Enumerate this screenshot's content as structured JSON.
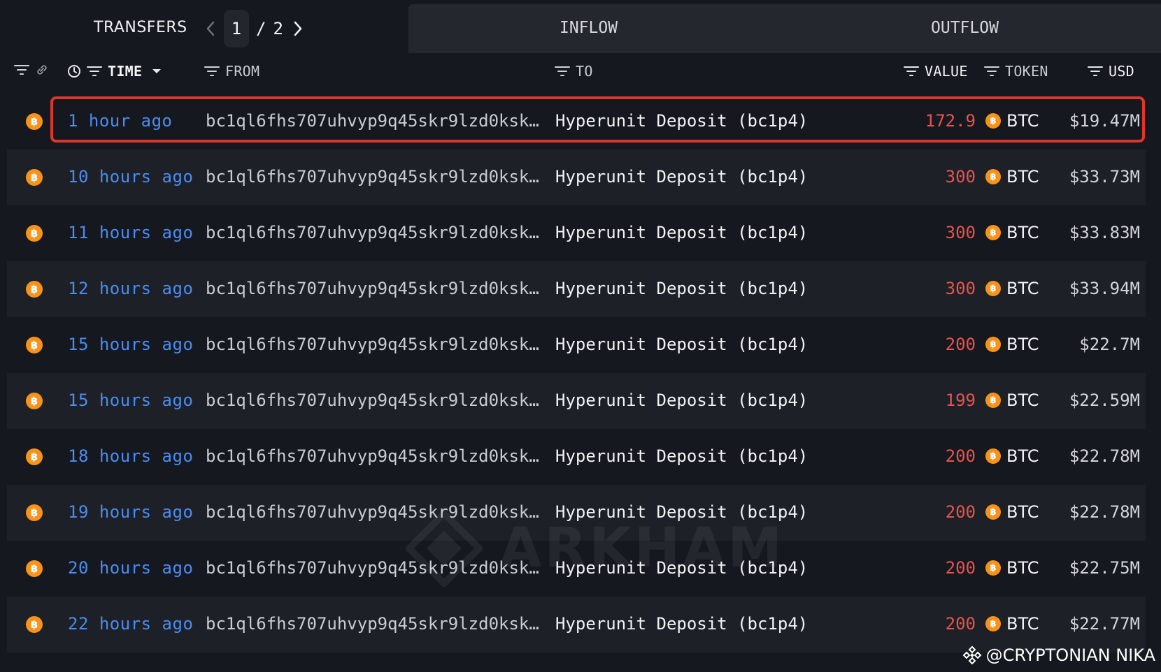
{
  "tabs": {
    "transfers_label": "TRANSFERS",
    "current_page": "1",
    "page_separator": "/",
    "total_pages": "2",
    "inflow_label": "INFLOW",
    "outflow_label": "OUTFLOW"
  },
  "columns": {
    "time": "TIME",
    "from": "FROM",
    "to": "TO",
    "value": "VALUE",
    "token": "TOKEN",
    "usd": "USD"
  },
  "rows": [
    {
      "time": "1 hour ago",
      "from": "bc1ql6fhs707uhvyp9q45skr9lzd0ksk…",
      "to": "Hyperunit Deposit (bc1p4)",
      "value": "172.9",
      "token": "BTC",
      "usd": "$19.47M",
      "coin_glyph": "฿"
    },
    {
      "time": "10 hours ago",
      "from": "bc1ql6fhs707uhvyp9q45skr9lzd0ksk…",
      "to": "Hyperunit Deposit (bc1p4)",
      "value": "300",
      "token": "BTC",
      "usd": "$33.73M",
      "coin_glyph": "฿"
    },
    {
      "time": "11 hours ago",
      "from": "bc1ql6fhs707uhvyp9q45skr9lzd0ksk…",
      "to": "Hyperunit Deposit (bc1p4)",
      "value": "300",
      "token": "BTC",
      "usd": "$33.83M",
      "coin_glyph": "฿"
    },
    {
      "time": "12 hours ago",
      "from": "bc1ql6fhs707uhvyp9q45skr9lzd0ksk…",
      "to": "Hyperunit Deposit (bc1p4)",
      "value": "300",
      "token": "BTC",
      "usd": "$33.94M",
      "coin_glyph": "฿"
    },
    {
      "time": "15 hours ago",
      "from": "bc1ql6fhs707uhvyp9q45skr9lzd0ksk…",
      "to": "Hyperunit Deposit (bc1p4)",
      "value": "200",
      "token": "BTC",
      "usd": "$22.7M",
      "coin_glyph": "฿"
    },
    {
      "time": "15 hours ago",
      "from": "bc1ql6fhs707uhvyp9q45skr9lzd0ksk…",
      "to": "Hyperunit Deposit (bc1p4)",
      "value": "199",
      "token": "BTC",
      "usd": "$22.59M",
      "coin_glyph": "฿"
    },
    {
      "time": "18 hours ago",
      "from": "bc1ql6fhs707uhvyp9q45skr9lzd0ksk…",
      "to": "Hyperunit Deposit (bc1p4)",
      "value": "200",
      "token": "BTC",
      "usd": "$22.78M",
      "coin_glyph": "฿"
    },
    {
      "time": "19 hours ago",
      "from": "bc1ql6fhs707uhvyp9q45skr9lzd0ksk…",
      "to": "Hyperunit Deposit (bc1p4)",
      "value": "200",
      "token": "BTC",
      "usd": "$22.78M",
      "coin_glyph": "฿"
    },
    {
      "time": "20 hours ago",
      "from": "bc1ql6fhs707uhvyp9q45skr9lzd0ksk…",
      "to": "Hyperunit Deposit (bc1p4)",
      "value": "200",
      "token": "BTC",
      "usd": "$22.75M",
      "coin_glyph": "฿"
    },
    {
      "time": "22 hours ago",
      "from": "bc1ql6fhs707uhvyp9q45skr9lzd0ksk…",
      "to": "Hyperunit Deposit (bc1p4)",
      "value": "200",
      "token": "BTC",
      "usd": "$22.77M",
      "coin_glyph": "฿"
    }
  ],
  "watermark": "ARKHAM",
  "credit": "@CRYPTONIAN NIKA",
  "colors": {
    "background": "#15181f",
    "row_alt": "#1d2027",
    "time_link": "#4b8cf0",
    "value_outflow": "#e8534d",
    "btc": "#f7931a",
    "highlight": "#e0352b"
  },
  "icons": {
    "filter": "filter-icon",
    "link": "link-icon",
    "clock": "clock-icon",
    "sort": "caret-down-icon",
    "prev": "chevron-left-icon",
    "next": "chevron-right-icon",
    "coin": "btc-coin-icon"
  }
}
